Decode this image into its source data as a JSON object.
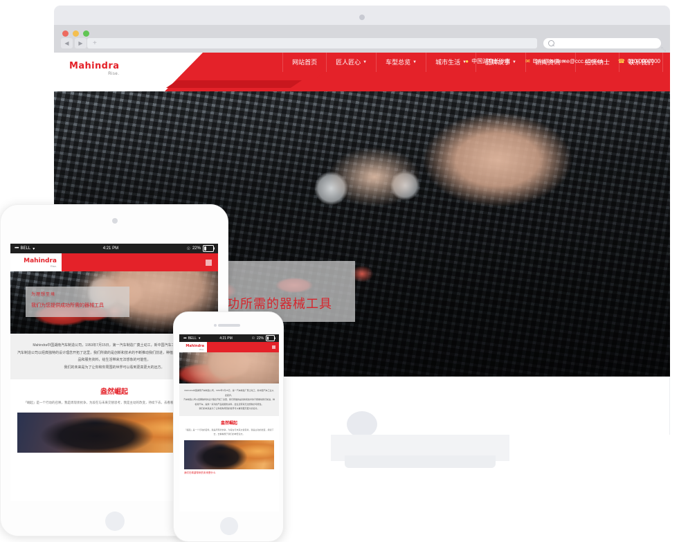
{
  "browser": {
    "traffic_lights": [
      "close",
      "minimize",
      "maximize"
    ],
    "back_label": "◀",
    "forward_label": "▶",
    "new_tab_label": "+",
    "search_placeholder": "",
    "resize_label": "⤡"
  },
  "site": {
    "logo": {
      "name": "Mahindra",
      "tagline": "Rise."
    },
    "topbar": {
      "location_icon": "location-pin-icon",
      "location": "中国湖南长沙市",
      "email_icon": "envelope-icon",
      "email": "E-mail:writeme@ccc.com.cn",
      "phone_icon": "phone-icon",
      "phone": "010-0000000"
    },
    "nav": [
      {
        "label": "网站首页",
        "has_caret": false
      },
      {
        "label": "匠人匠心",
        "has_caret": true
      },
      {
        "label": "车型总览",
        "has_caret": true
      },
      {
        "label": "城市生活",
        "has_caret": true
      },
      {
        "label": "品牌故事",
        "has_caret": true
      },
      {
        "label": "新闻资讯",
        "has_caret": true
      },
      {
        "label": "招贤纳士",
        "has_caret": false
      },
      {
        "label": "联系我们",
        "has_caret": false
      }
    ],
    "hero": {
      "image_name": "mechanic-tools-photo",
      "caption_line1": "为理想至境",
      "caption_line2": "我们为您提供成功所需的器械工具"
    }
  },
  "mobile_status": {
    "signal": "•••••",
    "carrier": "BELL",
    "wifi_icon": "wifi-icon",
    "time": "4:21 PM",
    "lock_icon": "lock-icon",
    "battery_percent": "22%"
  },
  "tablet": {
    "device_name": "tablet-device",
    "menu_icon": "hamburger-menu-icon",
    "hero": {
      "caption_line1": "为理想至境",
      "caption_line2": "我们为您提供成功所需的器械工具"
    },
    "intro": [
      "Mahindra中国湖南汽车制造公司，1953年7月15日，第一汽车制造厂奠土动工，新中国汽车工业从此起步。",
      "汽车制造公司以经典独特的设计理念开拓了这里，我们所做的是创新和技术的不断推动我们前进，种植用汽车，提供一系列的产品和服务资料，给生活带来无法想象的可能性。",
      "我们的未来是为了让你和你周围的世界可以看到更高更大的远方。"
    ],
    "section_title": "盎然崛起",
    "section_text": "「崛起」是一个行动的召唤，我是周现状抗争，为段在与未来交替思考，我是主动的改变，持续下去，去看看属于我们的神奇远方。",
    "image_name": "motorcycle-sunset-photo"
  },
  "phone": {
    "device_name": "phone-device",
    "menu_icon": "hamburger-menu-icon",
    "section_title": "盎然崛起",
    "image_name": "motorcycle-sunset-photo",
    "caption": "我们在希望带来的未来是什么"
  },
  "colors": {
    "brand_red": "#e42229",
    "brand_red_dark": "#c9171e",
    "caption_red": "#d6252c",
    "chrome_gray": "#d7d8dc",
    "screen_bezel": "#2f2f2f"
  }
}
